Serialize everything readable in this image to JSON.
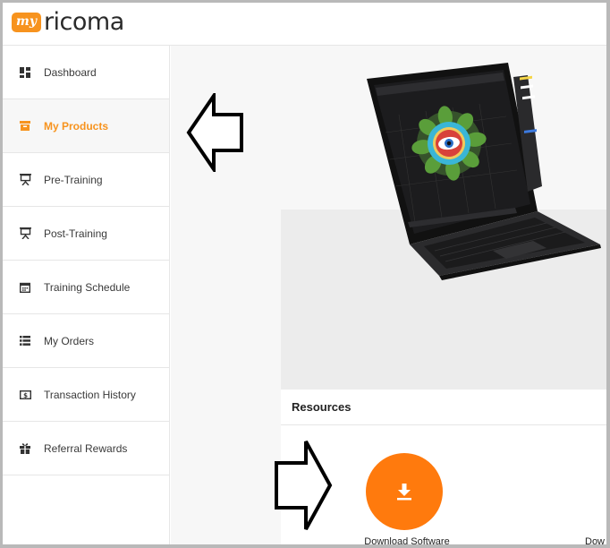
{
  "header": {
    "logo_my": "my",
    "logo_name": "ricoma"
  },
  "sidebar": {
    "items": [
      {
        "label": "Dashboard",
        "icon": "dashboard-icon",
        "active": false
      },
      {
        "label": "My Products",
        "icon": "box-icon",
        "active": true
      },
      {
        "label": "Pre-Training",
        "icon": "presentation-icon",
        "active": false
      },
      {
        "label": "Post-Training",
        "icon": "presentation-icon",
        "active": false
      },
      {
        "label": "Training Schedule",
        "icon": "calendar-icon",
        "active": false
      },
      {
        "label": "My Orders",
        "icon": "list-icon",
        "active": false
      },
      {
        "label": "Transaction History",
        "icon": "money-icon",
        "active": false
      },
      {
        "label": "Referral Rewards",
        "icon": "gift-icon",
        "active": false
      }
    ]
  },
  "main": {
    "resources_title": "Resources",
    "download_label": "Download Software",
    "download_label_2": "Dow"
  },
  "colors": {
    "accent": "#f7931e",
    "download_button": "#ff7a0d"
  }
}
